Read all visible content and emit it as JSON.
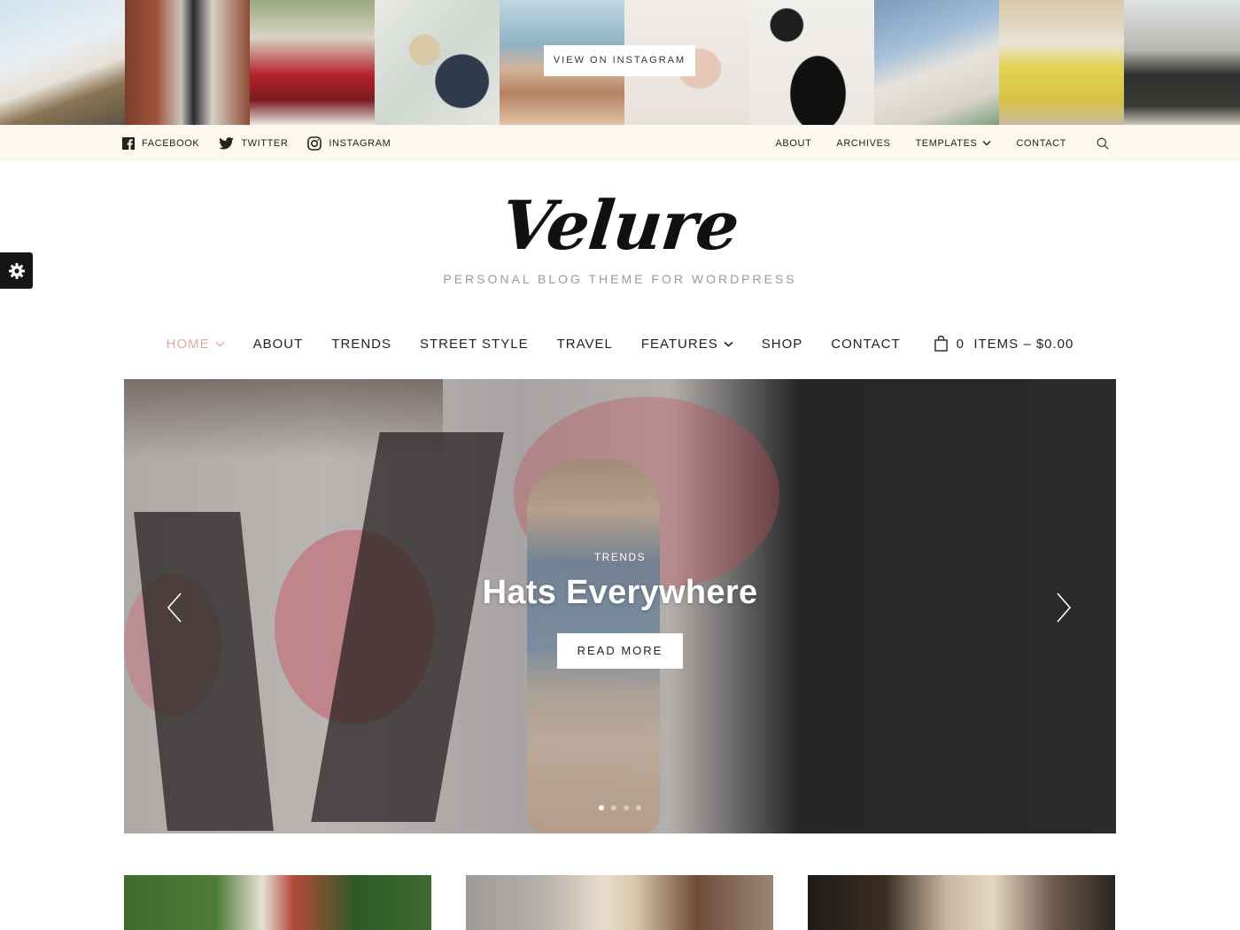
{
  "instagram": {
    "button_label": "VIEW ON INSTAGRAM",
    "tiles": [
      {
        "name": "beach-bag"
      },
      {
        "name": "brick-alley"
      },
      {
        "name": "red-skirt"
      },
      {
        "name": "flatlay-suitcase"
      },
      {
        "name": "beach-walk"
      },
      {
        "name": "sunglasses"
      },
      {
        "name": "accessories-flatlay"
      },
      {
        "name": "jeans-popcorn"
      },
      {
        "name": "yellow-skirt"
      },
      {
        "name": "street-coat"
      }
    ]
  },
  "topbar": {
    "social": [
      {
        "label": "FACEBOOK",
        "icon": "facebook-icon"
      },
      {
        "label": "TWITTER",
        "icon": "twitter-icon"
      },
      {
        "label": "INSTAGRAM",
        "icon": "instagram-icon"
      }
    ],
    "nav": [
      {
        "label": "ABOUT"
      },
      {
        "label": "ARCHIVES"
      },
      {
        "label": "TEMPLATES",
        "has_dropdown": true
      },
      {
        "label": "CONTACT"
      }
    ],
    "search_icon": "search-icon"
  },
  "branding": {
    "logo": "Velure",
    "tagline": "PERSONAL BLOG THEME FOR WORDPRESS"
  },
  "main_nav": {
    "items": [
      {
        "label": "HOME",
        "active": true,
        "has_dropdown": true
      },
      {
        "label": "ABOUT"
      },
      {
        "label": "TRENDS"
      },
      {
        "label": "STREET STYLE"
      },
      {
        "label": "TRAVEL"
      },
      {
        "label": "FEATURES",
        "has_dropdown": true
      },
      {
        "label": "SHOP"
      },
      {
        "label": "CONTACT"
      }
    ],
    "cart": {
      "count": "0",
      "label": "ITEMS",
      "total": "$0.00",
      "display": "0  ITEMS – $0.00"
    },
    "active_color": "#e3a9a1"
  },
  "hero": {
    "category": "TRENDS",
    "title": "Hats Everywhere",
    "button_label": "READ MORE",
    "slide_count": 4,
    "active_slide": 1
  },
  "colors": {
    "topbar_bg": "#fdf8ef",
    "settings_tab_bg": "#161616"
  }
}
